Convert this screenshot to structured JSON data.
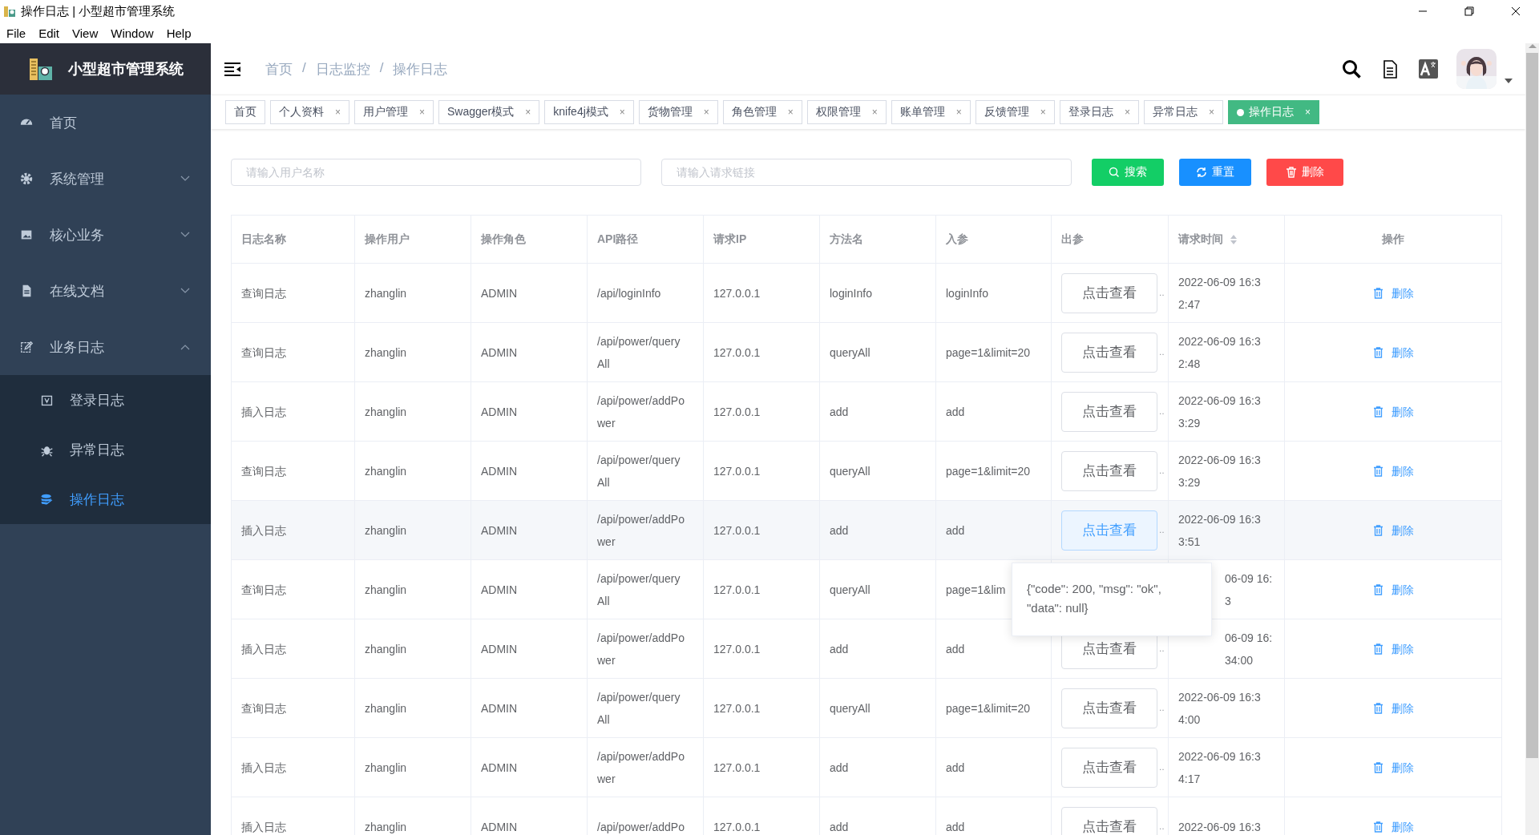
{
  "window": {
    "title": "操作日志 | 小型超市管理系统",
    "menu": [
      "File",
      "Edit",
      "View",
      "Window",
      "Help"
    ]
  },
  "sidebar": {
    "title": "小型超市管理系统",
    "items": [
      {
        "label": "首页",
        "kind": "link",
        "selected": false
      },
      {
        "label": "系统管理",
        "kind": "group",
        "expanded": false
      },
      {
        "label": "核心业务",
        "kind": "group",
        "expanded": false
      },
      {
        "label": "在线文档",
        "kind": "group",
        "expanded": false
      },
      {
        "label": "业务日志",
        "kind": "group",
        "expanded": true,
        "children": [
          {
            "label": "登录日志",
            "selected": false
          },
          {
            "label": "异常日志",
            "selected": false
          },
          {
            "label": "操作日志",
            "selected": true
          }
        ]
      }
    ]
  },
  "breadcrumb": {
    "separator": "/",
    "items": [
      "首页",
      "日志监控",
      "操作日志"
    ]
  },
  "tags": {
    "close": "×",
    "items": [
      {
        "label": "首页",
        "closable": false,
        "selected": false
      },
      {
        "label": "个人资料",
        "closable": true,
        "selected": false
      },
      {
        "label": "用户管理",
        "closable": true,
        "selected": false
      },
      {
        "label": "Swagger模式",
        "closable": true,
        "selected": false
      },
      {
        "label": "knife4j模式",
        "closable": true,
        "selected": false
      },
      {
        "label": "货物管理",
        "closable": true,
        "selected": false
      },
      {
        "label": "角色管理",
        "closable": true,
        "selected": false
      },
      {
        "label": "权限管理",
        "closable": true,
        "selected": false
      },
      {
        "label": "账单管理",
        "closable": true,
        "selected": false
      },
      {
        "label": "反馈管理",
        "closable": true,
        "selected": false
      },
      {
        "label": "登录日志",
        "closable": true,
        "selected": false
      },
      {
        "label": "异常日志",
        "closable": true,
        "selected": false
      },
      {
        "label": "操作日志",
        "closable": true,
        "selected": true
      }
    ]
  },
  "search": {
    "user_placeholder": "请输入用户名称",
    "url_placeholder": "请输入请求链接",
    "buttons": [
      {
        "label": "搜索",
        "kind": "search"
      },
      {
        "label": "重置",
        "kind": "reset"
      },
      {
        "label": "删除",
        "kind": "delete"
      }
    ]
  },
  "table": {
    "columns": [
      {
        "label": "日志名称",
        "sortable": false
      },
      {
        "label": "操作用户",
        "sortable": false
      },
      {
        "label": "操作角色",
        "sortable": false
      },
      {
        "label": "API路径",
        "sortable": false
      },
      {
        "label": "请求IP",
        "sortable": false
      },
      {
        "label": "方法名",
        "sortable": false
      },
      {
        "label": "入参",
        "sortable": false
      },
      {
        "label": "出参",
        "sortable": false
      },
      {
        "label": "请求时间",
        "sortable": true
      },
      {
        "label": "操作",
        "sortable": false
      }
    ],
    "rows": [
      {
        "name": "查询日志",
        "user": "zhanglin",
        "role": "ADMIN",
        "api": "/api/loginInfo",
        "ip": "127.0.0.1",
        "method": "loginInfo",
        "param": "loginInfo",
        "output": "点击查看",
        "more": "‥",
        "time": "2022-06-09 16:32:47",
        "action": "删除",
        "hovered": false,
        "covered": false
      },
      {
        "name": "查询日志",
        "user": "zhanglin",
        "role": "ADMIN",
        "api": "/api/power/queryAll",
        "ip": "127.0.0.1",
        "method": "queryAll",
        "param": "page=1&limit=20",
        "output": "点击查看",
        "more": "‥",
        "time": "2022-06-09 16:32:48",
        "action": "删除",
        "hovered": false,
        "covered": false
      },
      {
        "name": "插入日志",
        "user": "zhanglin",
        "role": "ADMIN",
        "api": "/api/power/addPower",
        "ip": "127.0.0.1",
        "method": "add",
        "param": "add",
        "output": "点击查看",
        "more": "‥",
        "time": "2022-06-09 16:33:29",
        "action": "删除",
        "hovered": false,
        "covered": false
      },
      {
        "name": "查询日志",
        "user": "zhanglin",
        "role": "ADMIN",
        "api": "/api/power/queryAll",
        "ip": "127.0.0.1",
        "method": "queryAll",
        "param": "page=1&limit=20",
        "output": "点击查看",
        "more": "‥",
        "time": "2022-06-09 16:33:29",
        "action": "删除",
        "hovered": false,
        "covered": false
      },
      {
        "name": "插入日志",
        "user": "zhanglin",
        "role": "ADMIN",
        "api": "/api/power/addPower",
        "ip": "127.0.0.1",
        "method": "add",
        "param": "add",
        "output": "点击查看",
        "more": "‥",
        "time": "2022-06-09 16:33:51",
        "action": "删除",
        "hovered": true,
        "covered": false
      },
      {
        "name": "查询日志",
        "user": "zhanglin",
        "role": "ADMIN",
        "api": "/api/power/queryAll",
        "ip": "127.0.0.1",
        "method": "queryAll",
        "param": "page=1&lim",
        "time": "06-09 16:3",
        "action": "删除",
        "hovered": false,
        "covered": true
      },
      {
        "name": "插入日志",
        "user": "zhanglin",
        "role": "ADMIN",
        "api": "/api/power/addPower",
        "ip": "127.0.0.1",
        "method": "add",
        "param": "add",
        "output": "点击查看",
        "more": "‥",
        "time": "06-09 16:34:00",
        "action": "删除",
        "hovered": false,
        "covered": true
      },
      {
        "name": "查询日志",
        "user": "zhanglin",
        "role": "ADMIN",
        "api": "/api/power/queryAll",
        "ip": "127.0.0.1",
        "method": "queryAll",
        "param": "page=1&limit=20",
        "output": "点击查看",
        "more": "‥",
        "time": "2022-06-09 16:34:00",
        "action": "删除",
        "hovered": false,
        "covered": false
      },
      {
        "name": "插入日志",
        "user": "zhanglin",
        "role": "ADMIN",
        "api": "/api/power/addPower",
        "ip": "127.0.0.1",
        "method": "add",
        "param": "add",
        "output": "点击查看",
        "more": "‥",
        "time": "2022-06-09 16:34:17",
        "action": "删除",
        "hovered": false,
        "covered": false
      },
      {
        "name": "插入日志",
        "user": "zhanglin",
        "role": "ADMIN",
        "api": "/api/power/addPo",
        "ip": "127.0.0.1",
        "method": "add",
        "param": "add",
        "output": "点击查看",
        "more": "‥",
        "time": "2022-06-09 16:3",
        "action": "删除",
        "hovered": false,
        "covered": false
      }
    ],
    "tooltip": "{\"code\": 200, \"msg\": \"ok\", \"data\": null}"
  }
}
